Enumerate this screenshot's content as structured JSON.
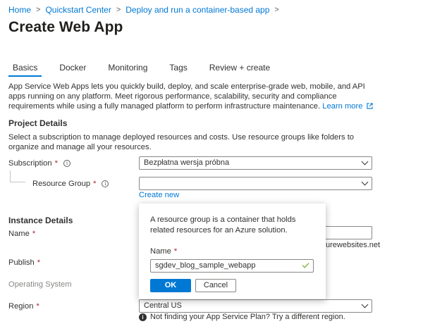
{
  "breadcrumb": {
    "items": [
      "Home",
      "Quickstart Center",
      "Deploy and run a container-based app"
    ],
    "separator": ">"
  },
  "page_title": "Create Web App",
  "tabs": [
    {
      "label": "Basics",
      "active": true
    },
    {
      "label": "Docker",
      "active": false
    },
    {
      "label": "Monitoring",
      "active": false
    },
    {
      "label": "Tags",
      "active": false
    },
    {
      "label": "Review + create",
      "active": false
    }
  ],
  "intro": {
    "text": "App Service Web Apps lets you quickly build, deploy, and scale enterprise-grade web, mobile, and API apps running on any platform. Meet rigorous performance, scalability, security and compliance requirements while using a fully managed platform to perform infrastructure maintenance.",
    "learn_more": "Learn more"
  },
  "project_details": {
    "heading": "Project Details",
    "description": "Select a subscription to manage deployed resources and costs. Use resource groups like folders to organize and manage all your resources.",
    "subscription_label": "Subscription",
    "subscription_value": "Bezpłatna wersja próbna",
    "resource_group_label": "Resource Group",
    "resource_group_value": "",
    "create_new": "Create new"
  },
  "instance_details": {
    "heading": "Instance Details",
    "name_label": "Name",
    "name_suffix": "urewebsites.net",
    "publish_label": "Publish",
    "os_label": "Operating System",
    "region_label": "Region",
    "region_value": "Central US",
    "region_hint": "Not finding your App Service Plan? Try a different region."
  },
  "required_marker": "*",
  "popup": {
    "description": "A resource group is a container that holds related resources for an Azure solution.",
    "name_label": "Name",
    "name_value": "sgdev_blog_sample_webapp",
    "ok_label": "OK",
    "cancel_label": "Cancel"
  },
  "colors": {
    "accent": "#0078d4",
    "required": "#a4262c",
    "valid": "#57a300"
  },
  "icons": [
    "chevron-right-icon",
    "info-icon",
    "chevron-down-icon",
    "external-link-icon",
    "checkmark-icon",
    "info-filled-icon"
  ]
}
